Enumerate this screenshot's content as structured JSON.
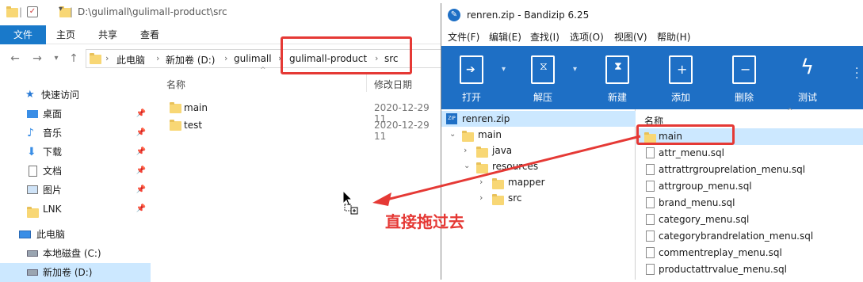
{
  "explorer": {
    "path_title": "D:\\gulimall\\gulimall-product\\src",
    "ribbon_tabs": [
      "文件",
      "主页",
      "共享",
      "查看"
    ],
    "breadcrumbs": [
      "此电脑",
      "新加卷 (D:)",
      "gulimall",
      "gulimall-product",
      "src"
    ],
    "nav_items": [
      {
        "label": "快速访问",
        "icon": "star-icon"
      },
      {
        "label": "桌面",
        "icon": "desktop-icon"
      },
      {
        "label": "音乐",
        "icon": "music-icon"
      },
      {
        "label": "下载",
        "icon": "download-icon"
      },
      {
        "label": "文档",
        "icon": "document-icon"
      },
      {
        "label": "图片",
        "icon": "picture-icon"
      },
      {
        "label": "LNK",
        "icon": "folder-icon"
      },
      {
        "label": "此电脑",
        "icon": "computer-icon"
      },
      {
        "label": "本地磁盘 (C:)",
        "icon": "drive-icon"
      },
      {
        "label": "新加卷 (D:)",
        "icon": "drive-icon"
      }
    ],
    "columns": {
      "name": "名称",
      "modified": "修改日期"
    },
    "rows": [
      {
        "name": "main",
        "modified": "2020-12-29 11"
      },
      {
        "name": "test",
        "modified": "2020-12-29 11"
      }
    ]
  },
  "bandizip": {
    "title": "renren.zip - Bandizip 6.25",
    "menu": [
      "文件(F)",
      "编辑(E)",
      "查找(I)",
      "选项(O)",
      "视图(V)",
      "帮助(H)"
    ],
    "toolbar": [
      "打开",
      "解压",
      "新建",
      "添加",
      "删除",
      "测试"
    ],
    "tree": [
      {
        "label": "renren.zip",
        "level": 0
      },
      {
        "label": "main",
        "level": 1
      },
      {
        "label": "java",
        "level": 2
      },
      {
        "label": "resources",
        "level": 2
      },
      {
        "label": "mapper",
        "level": 3
      },
      {
        "label": "src",
        "level": 3
      }
    ],
    "list_header": "名称",
    "files": [
      {
        "name": "main",
        "type": "folder"
      },
      {
        "name": "attr_menu.sql",
        "type": "file"
      },
      {
        "name": "attrattrgrouprelation_menu.sql",
        "type": "file"
      },
      {
        "name": "attrgroup_menu.sql",
        "type": "file"
      },
      {
        "name": "brand_menu.sql",
        "type": "file"
      },
      {
        "name": "category_menu.sql",
        "type": "file"
      },
      {
        "name": "categorybrandrelation_menu.sql",
        "type": "file"
      },
      {
        "name": "commentreplay_menu.sql",
        "type": "file"
      },
      {
        "name": "productattrvalue_menu.sql",
        "type": "file"
      }
    ]
  },
  "annotation": {
    "text": "直接拖过去",
    "color": "#e53935"
  }
}
